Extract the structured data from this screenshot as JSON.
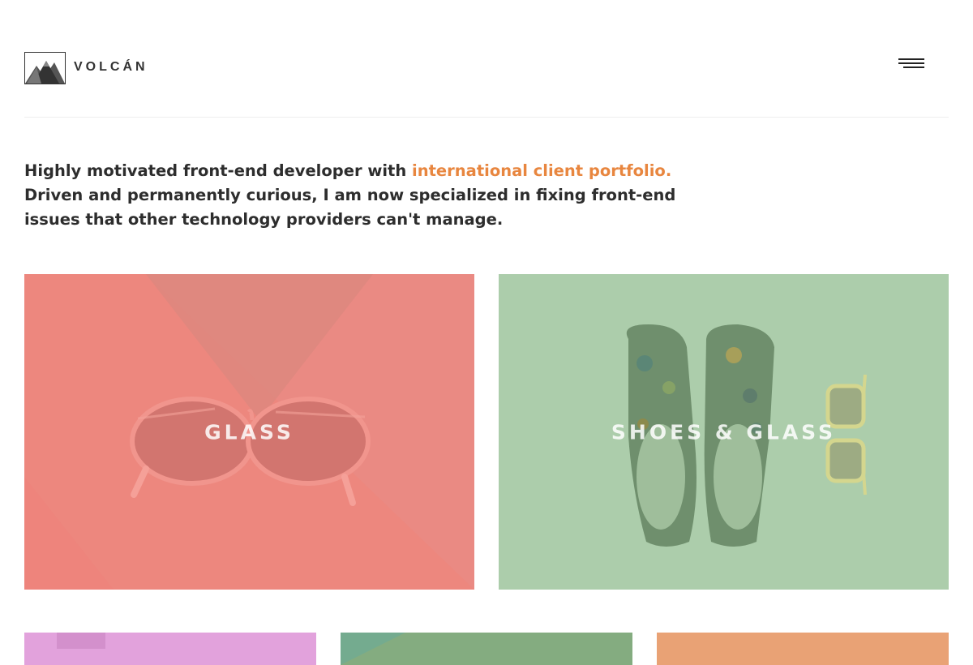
{
  "brand": {
    "name": "VOLCÁN"
  },
  "header": {
    "menu_icon": "hamburger-menu-icon",
    "logo_icon": "mountain-logo-icon"
  },
  "intro": {
    "text_before": "Highly motivated front-end developer with ",
    "highlight": "international client portfolio.",
    "text_after": " Driven and permanently curious, I am now specialized in fixing front-end issues that other technology providers can't manage."
  },
  "colors": {
    "accent": "#e8863f",
    "text": "#2d2d2d",
    "tile_glass": "#ea8a83",
    "tile_shoes": "#accdab",
    "tile_pink": "#e2a2dc",
    "tile_green": "#84ac80",
    "tile_orange": "#e9a275"
  },
  "portfolio": {
    "featured": [
      {
        "label": "GLASS"
      },
      {
        "label": "SHOES & GLASS"
      }
    ]
  }
}
